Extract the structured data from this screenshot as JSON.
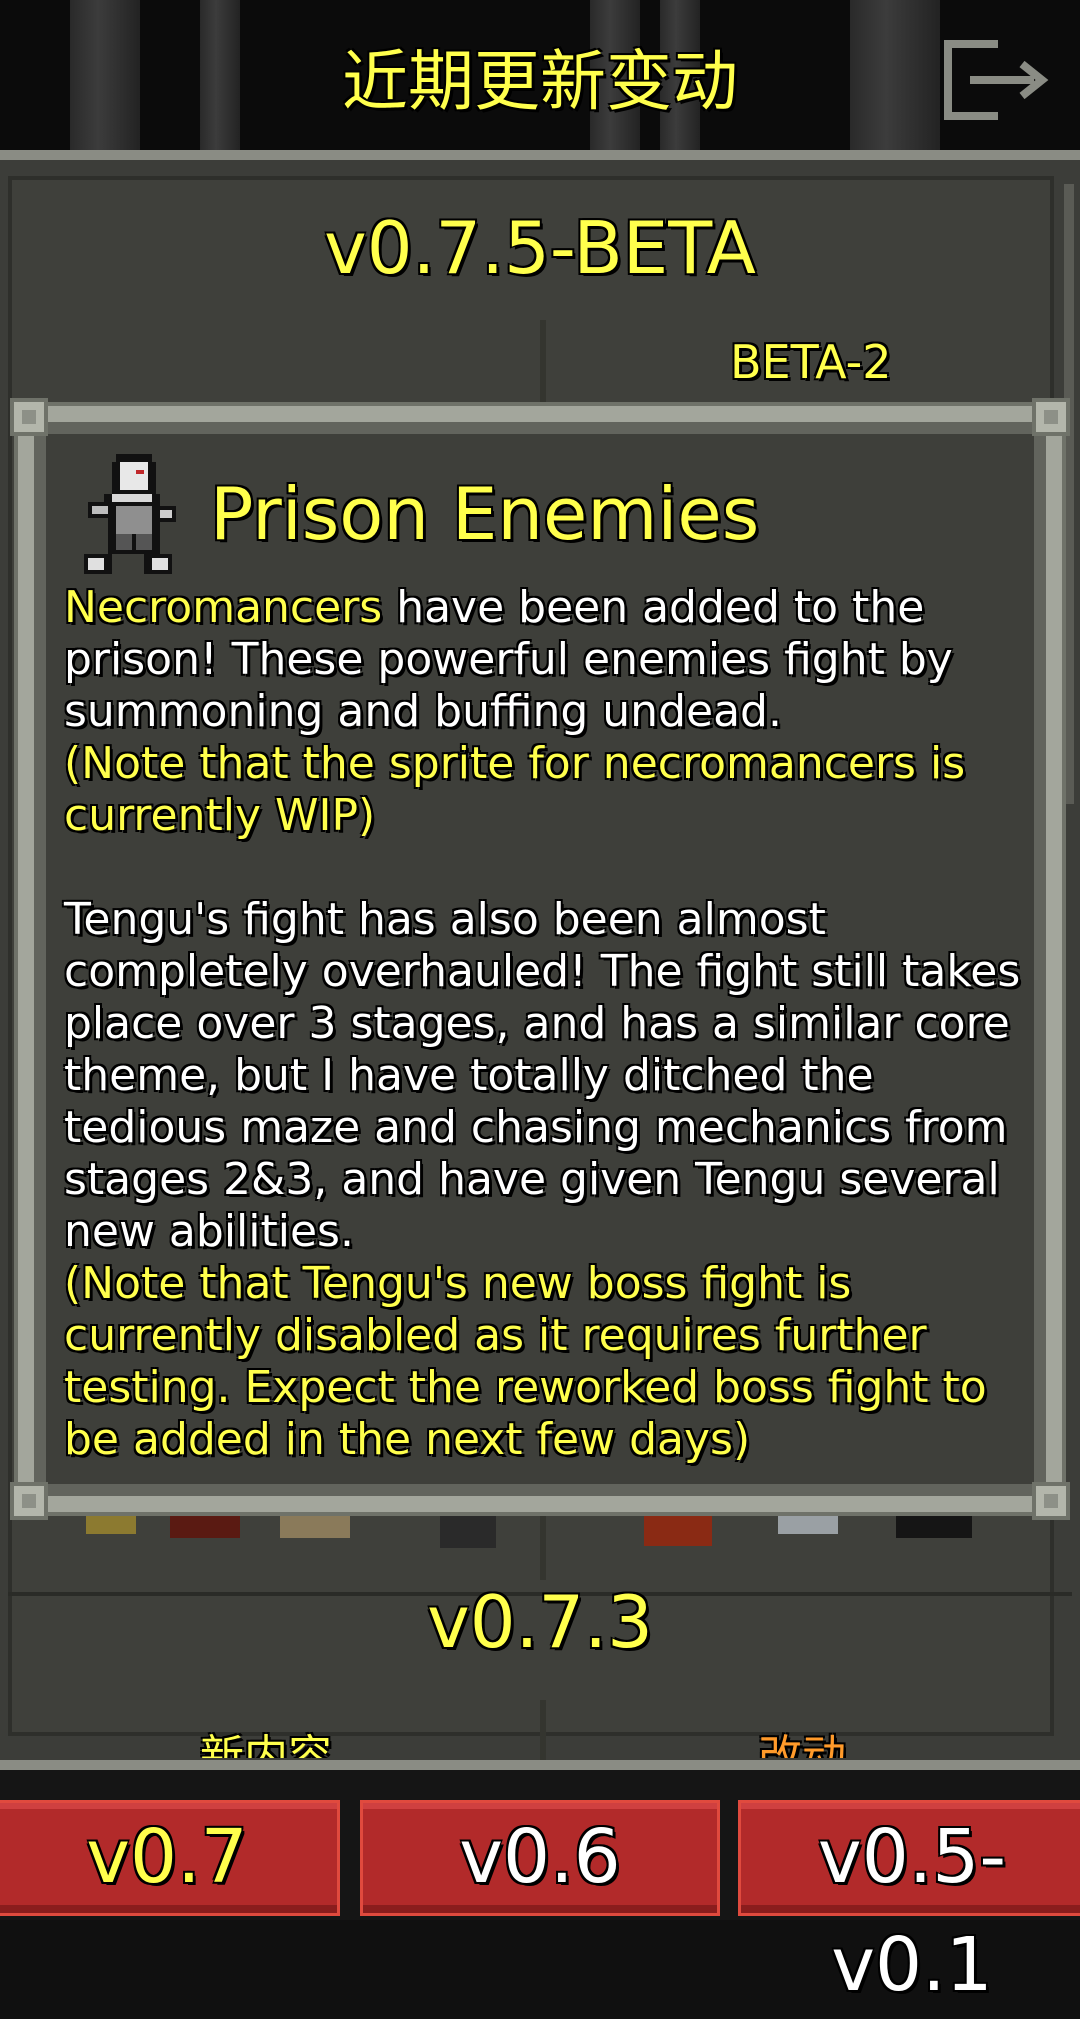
{
  "header": {
    "title": "近期更新变动",
    "exit_icon": "exit-door-icon"
  },
  "changes_list": {
    "version_current": "v0.7.5-BETA",
    "beta_label": "BETA-2",
    "version_previous": "v0.7.3",
    "column_new_label": "新内容",
    "column_changes_label": "改动"
  },
  "window": {
    "icon": "necromancer-sprite-icon",
    "title": "Prison Enemies",
    "p1_highlight": "Necromancers",
    "p1_text": " have been added to the prison! These powerful enemies fight by summoning and buffing undead.",
    "p1_note": "(Note that the sprite for necromancers is currently WIP)",
    "p2_text": "Tengu's fight has also been almost completely overhauled! The fight still takes place over 3 stages, and has a similar core theme, but I have totally ditched the tedious maze and chasing mechanics from stages 2&3, and have given Tengu several new abilities.",
    "p2_note": "(Note that Tengu's new boss fight is currently disabled as it requires further testing. Expect the reworked boss fight to be added in the next few days)"
  },
  "tabs": [
    {
      "label": "v0.7",
      "selected": true
    },
    {
      "label": "v0.6",
      "selected": false
    },
    {
      "label": "v0.5-v0.1",
      "selected": false
    }
  ],
  "colors": {
    "highlight": "#ffff4c",
    "orange_label": "#ff9a2a",
    "tab_red": "#b22a2a",
    "panel": "#3f403b"
  }
}
